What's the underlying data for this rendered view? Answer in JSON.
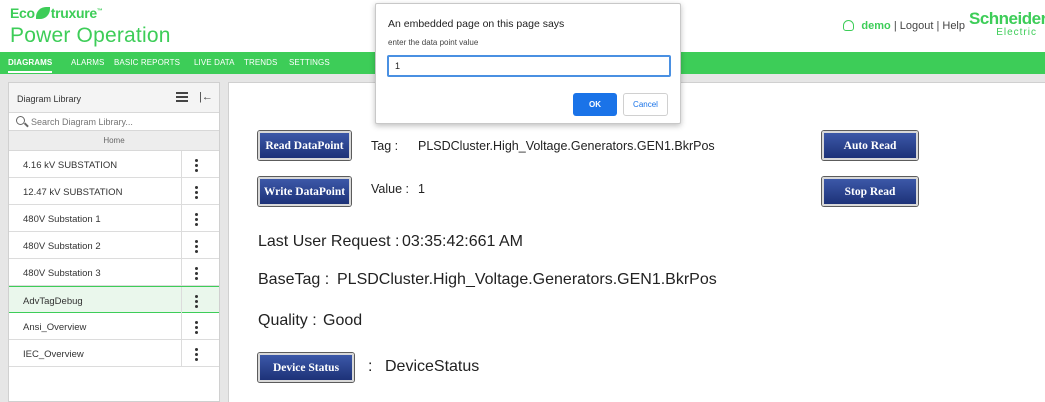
{
  "header": {
    "brand_eco": "Eco",
    "brand_struxure": "truxure",
    "brand_trademark": "™",
    "app_name": "Power Operation",
    "username": "demo",
    "separator": "|",
    "logout": "Logout",
    "help": "Help",
    "logo_line1": "Schneider",
    "logo_line2": "Electric"
  },
  "nav": {
    "items": [
      "DIAGRAMS",
      "ALARMS",
      "BASIC REPORTS",
      "LIVE DATA",
      "TRENDS",
      "SETTINGS"
    ],
    "active": "DIAGRAMS"
  },
  "sidebar": {
    "title": "Diagram Library",
    "search_placeholder": "Search Diagram Library...",
    "home": "Home",
    "items": [
      {
        "label": "4.16 kV SUBSTATION"
      },
      {
        "label": "12.47 kV SUBSTATION"
      },
      {
        "label": "480V Substation 1"
      },
      {
        "label": "480V Substation 2"
      },
      {
        "label": "480V Substation 3"
      },
      {
        "label": "AdvTagDebug",
        "selected": true
      },
      {
        "label": "Ansi_Overview"
      },
      {
        "label": "IEC_Overview"
      }
    ]
  },
  "main": {
    "read_btn": "Read DataPoint",
    "write_btn": "Write DataPoint",
    "auto_read_btn": "Auto Read",
    "stop_read_btn": "Stop Read",
    "device_status_btn": "Device Status",
    "tag_label": "Tag :",
    "tag_value": "PLSDCluster.High_Voltage.Generators.GEN1.BkrPos",
    "value_label": "Value :",
    "value_value": "1",
    "last_request_label": "Last User Request :",
    "last_request_value": "03:35:42:661 AM",
    "basetag_label": "BaseTag :",
    "basetag_value": "PLSDCluster.High_Voltage.Generators.GEN1.BkrPos",
    "quality_label": "Quality :",
    "quality_value": "Good",
    "device_status_sep": ":",
    "device_status_value": "DeviceStatus"
  },
  "dialog": {
    "title": "An embedded page on this page says",
    "message": "enter the data point value",
    "input_value": "1",
    "ok": "OK",
    "cancel": "Cancel"
  },
  "colors": {
    "brand_green": "#3dcd58",
    "button_blue": "#1d3278",
    "dialog_ok": "#1a73e8"
  }
}
